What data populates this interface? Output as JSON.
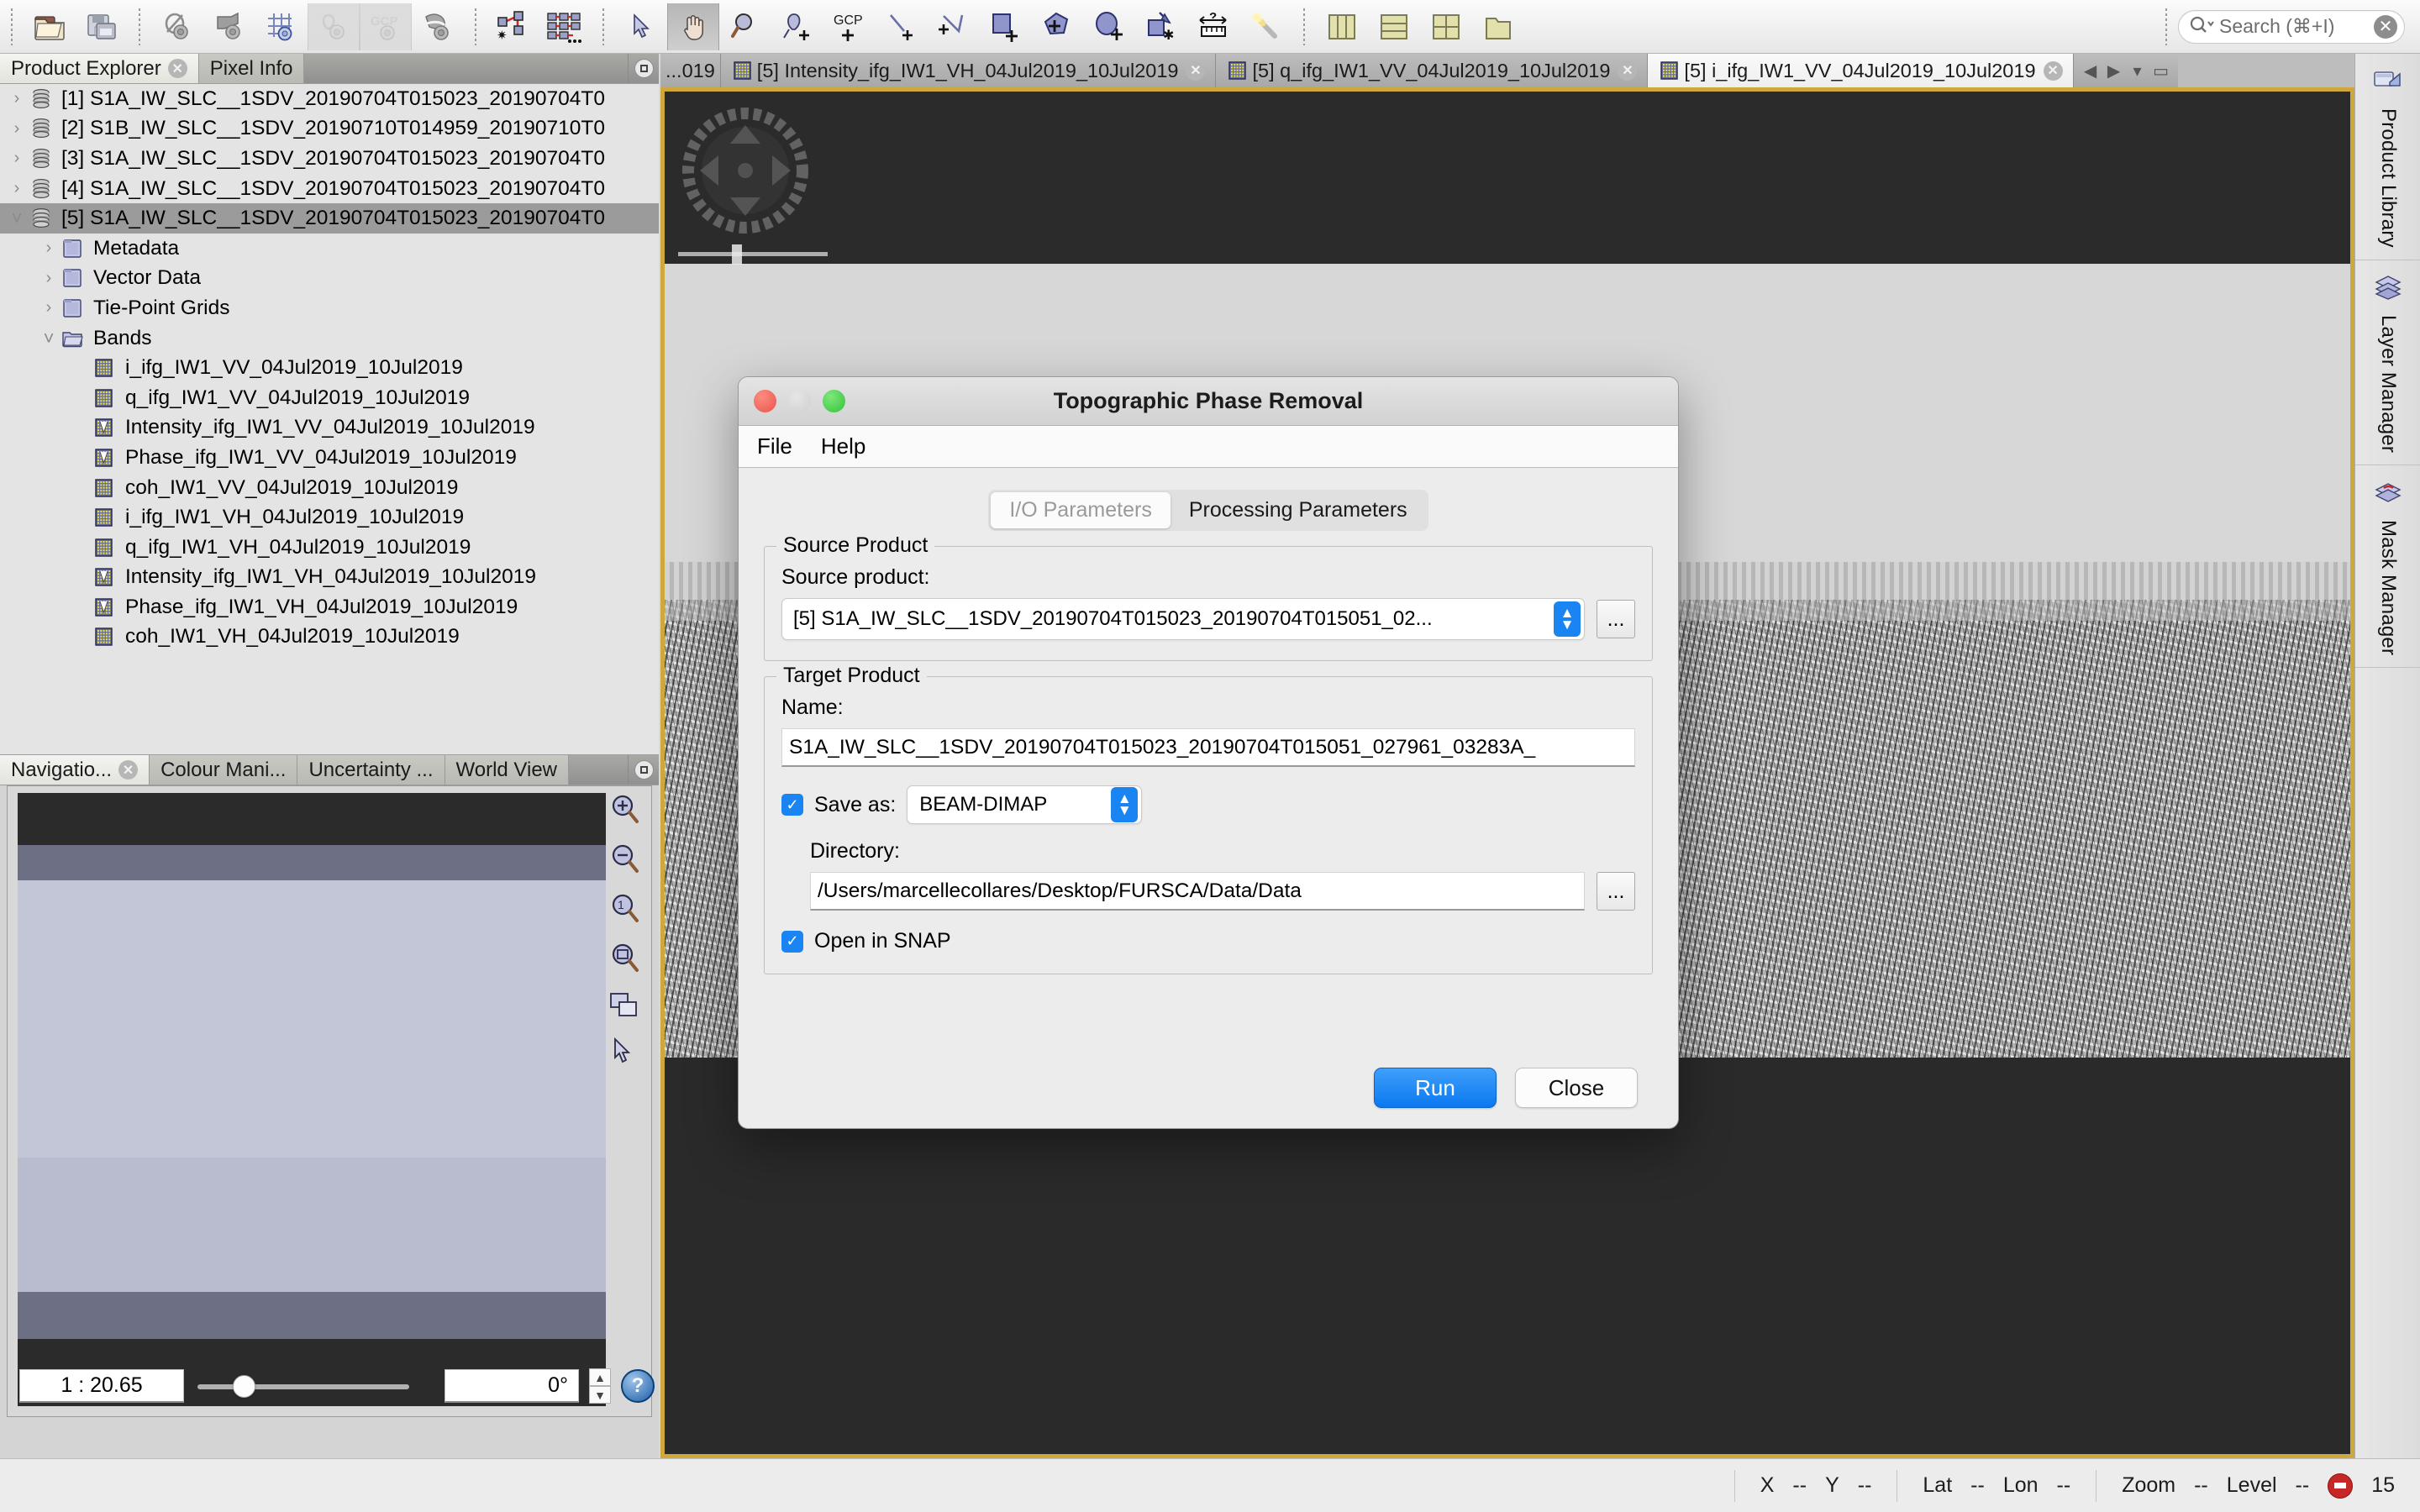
{
  "toolbar": {
    "icons": [
      {
        "name": "open-product-icon",
        "label": "Open Product",
        "state": "enabled"
      },
      {
        "name": "save-product-icon",
        "label": "Save Product",
        "state": "enabled"
      },
      {
        "name": "no-data-overlay-icon",
        "label": "No-Data Overlay",
        "state": "enabled"
      },
      {
        "name": "geo-overlay-icon",
        "label": "Geo Overlay",
        "state": "enabled"
      },
      {
        "name": "graticule-overlay-icon",
        "label": "Graticule Overlay",
        "state": "enabled"
      },
      {
        "name": "pin-overlay-icon",
        "label": "Pin Overlay",
        "state": "disabled"
      },
      {
        "name": "gcp-overlay-icon",
        "label": "GCP Overlay",
        "state": "disabled"
      },
      {
        "name": "mask-overlay-icon",
        "label": "Mask Overlay",
        "state": "enabled"
      },
      {
        "name": "graph-builder-icon",
        "label": "Graph Builder",
        "state": "enabled"
      },
      {
        "name": "batch-processing-icon",
        "label": "Batch Processing",
        "state": "enabled"
      },
      {
        "name": "selection-tool-icon",
        "label": "Selection",
        "state": "enabled"
      },
      {
        "name": "pan-tool-icon",
        "label": "Pan",
        "state": "selected"
      },
      {
        "name": "zoom-tool-icon",
        "label": "Zoom",
        "state": "enabled"
      },
      {
        "name": "pin-placing-tool-icon",
        "label": "Pin Placing Tool",
        "state": "enabled"
      },
      {
        "name": "gcp-placing-tool-icon",
        "label": "GCP Placing Tool",
        "state": "enabled"
      },
      {
        "name": "line-drawing-tool-icon",
        "label": "Line Drawing Tool",
        "state": "enabled"
      },
      {
        "name": "polyline-drawing-tool-icon",
        "label": "Polyline Drawing Tool",
        "state": "enabled"
      },
      {
        "name": "rectangle-drawing-tool-icon",
        "label": "Rectangle Drawing Tool",
        "state": "enabled"
      },
      {
        "name": "polygon-drawing-tool-icon",
        "label": "Polygon Drawing Tool",
        "state": "enabled"
      },
      {
        "name": "ellipse-drawing-tool-icon",
        "label": "Ellipse Drawing Tool",
        "state": "enabled"
      },
      {
        "name": "magic-wand-select-icon",
        "label": "Magic Wand Select",
        "state": "enabled"
      },
      {
        "name": "range-finder-icon",
        "label": "Range Finder",
        "state": "enabled"
      },
      {
        "name": "magic-stick-icon",
        "label": "Magic Stick",
        "state": "enabled"
      },
      {
        "name": "tile-vertically-icon",
        "label": "Tile Vertically",
        "state": "enabled"
      },
      {
        "name": "tile-horizontally-icon",
        "label": "Tile Horizontally",
        "state": "enabled"
      },
      {
        "name": "tile-evenly-icon",
        "label": "Tile Evenly",
        "state": "enabled"
      },
      {
        "name": "tile-single-icon",
        "label": "Tile Single",
        "state": "enabled"
      }
    ],
    "search_placeholder": "Search (⌘+I)"
  },
  "left_panel": {
    "tabs": [
      {
        "label": "Product Explorer",
        "active": true,
        "closable": true
      },
      {
        "label": "Pixel Info",
        "active": false,
        "closable": false
      }
    ],
    "tree": [
      {
        "label": "[1] S1A_IW_SLC__1SDV_20190704T015023_20190704T0",
        "icon": "product-icon",
        "depth": 0,
        "twist": "closed",
        "selected": false
      },
      {
        "label": "[2] S1B_IW_SLC__1SDV_20190710T014959_20190710T0",
        "icon": "product-icon",
        "depth": 0,
        "twist": "closed",
        "selected": false
      },
      {
        "label": "[3] S1A_IW_SLC__1SDV_20190704T015023_20190704T0",
        "icon": "product-icon",
        "depth": 0,
        "twist": "closed",
        "selected": false
      },
      {
        "label": "[4] S1A_IW_SLC__1SDV_20190704T015023_20190704T0",
        "icon": "product-icon",
        "depth": 0,
        "twist": "closed",
        "selected": false
      },
      {
        "label": "[5] S1A_IW_SLC__1SDV_20190704T015023_20190704T0",
        "icon": "product-icon",
        "depth": 0,
        "twist": "open",
        "selected": true
      },
      {
        "label": "Metadata",
        "icon": "folder-icon",
        "depth": 1,
        "twist": "closed",
        "selected": false
      },
      {
        "label": "Vector Data",
        "icon": "folder-icon",
        "depth": 1,
        "twist": "closed",
        "selected": false
      },
      {
        "label": "Tie-Point Grids",
        "icon": "folder-icon",
        "depth": 1,
        "twist": "closed",
        "selected": false
      },
      {
        "label": "Bands",
        "icon": "folder-open-icon",
        "depth": 1,
        "twist": "open",
        "selected": false
      },
      {
        "label": "i_ifg_IW1_VV_04Jul2019_10Jul2019",
        "icon": "band-icon",
        "depth": 2,
        "twist": "none",
        "selected": false
      },
      {
        "label": "q_ifg_IW1_VV_04Jul2019_10Jul2019",
        "icon": "band-icon",
        "depth": 2,
        "twist": "none",
        "selected": false
      },
      {
        "label": "Intensity_ifg_IW1_VV_04Jul2019_10Jul2019",
        "icon": "virtual-band-icon",
        "depth": 2,
        "twist": "none",
        "selected": false
      },
      {
        "label": "Phase_ifg_IW1_VV_04Jul2019_10Jul2019",
        "icon": "virtual-band-icon",
        "depth": 2,
        "twist": "none",
        "selected": false
      },
      {
        "label": "coh_IW1_VV_04Jul2019_10Jul2019",
        "icon": "band-icon",
        "depth": 2,
        "twist": "none",
        "selected": false
      },
      {
        "label": "i_ifg_IW1_VH_04Jul2019_10Jul2019",
        "icon": "band-icon",
        "depth": 2,
        "twist": "none",
        "selected": false
      },
      {
        "label": "q_ifg_IW1_VH_04Jul2019_10Jul2019",
        "icon": "band-icon",
        "depth": 2,
        "twist": "none",
        "selected": false
      },
      {
        "label": "Intensity_ifg_IW1_VH_04Jul2019_10Jul2019",
        "icon": "virtual-band-icon",
        "depth": 2,
        "twist": "none",
        "selected": false
      },
      {
        "label": "Phase_ifg_IW1_VH_04Jul2019_10Jul2019",
        "icon": "virtual-band-icon",
        "depth": 2,
        "twist": "none",
        "selected": false
      },
      {
        "label": "coh_IW1_VH_04Jul2019_10Jul2019",
        "icon": "band-icon",
        "depth": 2,
        "twist": "none",
        "selected": false
      }
    ]
  },
  "navigation_panel": {
    "tabs": [
      {
        "label": "Navigatio...",
        "active": true,
        "closable": true
      },
      {
        "label": "Colour Mani...",
        "active": false,
        "closable": false
      },
      {
        "label": "Uncertainty ...",
        "active": false,
        "closable": false
      },
      {
        "label": "World View",
        "active": false,
        "closable": false
      }
    ],
    "tools": [
      {
        "name": "zoom-in-icon",
        "label": "Zoom In"
      },
      {
        "name": "zoom-out-icon",
        "label": "Zoom Out"
      },
      {
        "name": "zoom-to-pixel-icon",
        "label": "Zoom to Pixel Resolution"
      },
      {
        "name": "zoom-all-icon",
        "label": "Zoom All"
      },
      {
        "name": "sync-views-icon",
        "label": "Synchronise Views"
      },
      {
        "name": "sync-cursor-icon",
        "label": "Synchronise Cursors"
      }
    ],
    "zoom_ratio": "1 : 20.65",
    "rotation": "0°",
    "help_label": "?"
  },
  "editor": {
    "tabs": [
      {
        "label": "...019",
        "active": false,
        "truncated": true,
        "closable": false
      },
      {
        "label": "[5] Intensity_ifg_IW1_VH_04Jul2019_10Jul2019",
        "active": false,
        "truncated": false,
        "closable": true
      },
      {
        "label": "[5] q_ifg_IW1_VV_04Jul2019_10Jul2019",
        "active": false,
        "truncated": false,
        "closable": true
      },
      {
        "label": "[5] i_ifg_IW1_VV_04Jul2019_10Jul2019",
        "active": true,
        "truncated": false,
        "closable": true
      }
    ],
    "tab_nav": [
      {
        "name": "tab-prev-button",
        "glyph": "◀"
      },
      {
        "name": "tab-next-button",
        "glyph": "▶"
      },
      {
        "name": "tab-list-button",
        "glyph": "▾"
      },
      {
        "name": "tab-maximize-button",
        "glyph": "▭"
      }
    ]
  },
  "right_sidebar": {
    "tabs": [
      {
        "label": "Product Library",
        "icon": "product-library-icon"
      },
      {
        "label": "Layer Manager",
        "icon": "layer-manager-icon"
      },
      {
        "label": "Mask Manager",
        "icon": "mask-manager-icon"
      }
    ]
  },
  "status_bar": {
    "x_label": "X",
    "x_value": "--",
    "y_label": "Y",
    "y_value": "--",
    "lat_label": "Lat",
    "lat_value": "--",
    "lon_label": "Lon",
    "lon_value": "--",
    "zoom_label": "Zoom",
    "zoom_value": "--",
    "level_label": "Level",
    "level_value": "--",
    "memory_value": "15"
  },
  "dialog": {
    "title": "Topographic Phase Removal",
    "menu": [
      {
        "label": "File"
      },
      {
        "label": "Help"
      }
    ],
    "tabs": [
      {
        "label": "I/O Parameters",
        "selected": true
      },
      {
        "label": "Processing Parameters",
        "selected": false
      }
    ],
    "source_group": {
      "legend": "Source Product",
      "field_label": "Source product:",
      "value": "[5] S1A_IW_SLC__1SDV_20190704T015023_20190704T015051_02...",
      "browse_label": "..."
    },
    "target_group": {
      "legend": "Target Product",
      "name_label": "Name:",
      "name_value": "S1A_IW_SLC__1SDV_20190704T015023_20190704T015051_027961_03283A_",
      "save_as_label": "Save as:",
      "save_as_checked": true,
      "format_value": "BEAM-DIMAP",
      "directory_label": "Directory:",
      "directory_value": "/Users/marcellecollares/Desktop/FURSCA/Data/Data",
      "directory_browse_label": "...",
      "open_in_snap_label": "Open in SNAP",
      "open_in_snap_checked": true
    },
    "buttons": {
      "run_label": "Run",
      "close_label": "Close"
    }
  },
  "colors": {
    "accent_blue": "#1a84f2",
    "window_border_gold": "#cfa83c",
    "selection_grey": "#9b9b9b",
    "status_red": "#c62828"
  }
}
